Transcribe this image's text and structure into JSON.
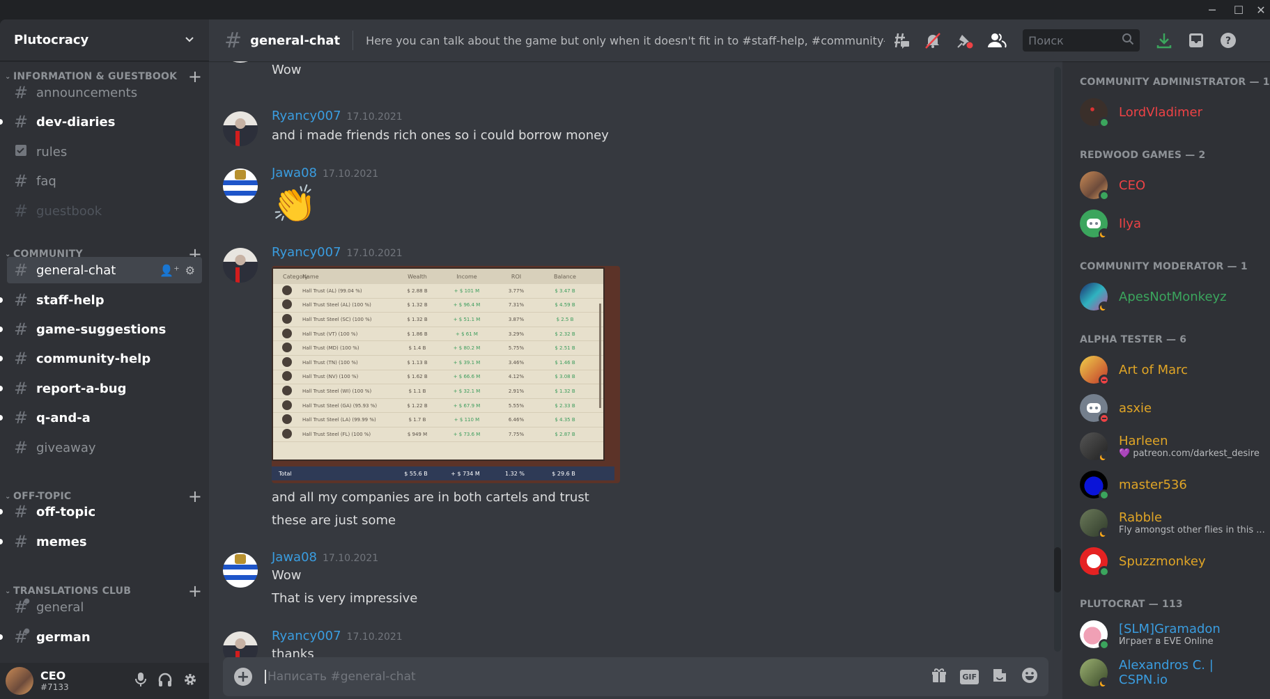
{
  "window": {
    "minimize_icon": "minimize-icon",
    "maximize_icon": "maximize-icon",
    "close_icon": "close-icon",
    "minimize": "─",
    "maximize": "☐",
    "close": "✕"
  },
  "server": {
    "name": "Plutocracy",
    "dropdown_icon": "⌄"
  },
  "sidebar": {
    "categories": [
      {
        "label": "INFORMATION & GUESTBOOK",
        "channels": [
          {
            "name": "announcements",
            "state": "read",
            "icon": "#"
          },
          {
            "name": "dev-diaries",
            "state": "unread",
            "icon": "#"
          },
          {
            "name": "rules",
            "state": "read",
            "icon": "☑"
          },
          {
            "name": "faq",
            "state": "read",
            "icon": "#"
          },
          {
            "name": "guestbook",
            "state": "muted",
            "icon": "#"
          }
        ]
      },
      {
        "label": "COMMUNITY",
        "channels": [
          {
            "name": "general-chat",
            "state": "active",
            "icon": "#"
          },
          {
            "name": "staff-help",
            "state": "unread",
            "icon": "#"
          },
          {
            "name": "game-suggestions",
            "state": "unread",
            "icon": "#"
          },
          {
            "name": "community-help",
            "state": "unread",
            "icon": "#"
          },
          {
            "name": "report-a-bug",
            "state": "unread",
            "icon": "#"
          },
          {
            "name": "q-and-a",
            "state": "unread",
            "icon": "#"
          },
          {
            "name": "giveaway",
            "state": "read",
            "icon": "#"
          }
        ]
      },
      {
        "label": "OFF-TOPIC",
        "channels": [
          {
            "name": "off-topic",
            "state": "unread",
            "icon": "#"
          },
          {
            "name": "memes",
            "state": "unread",
            "icon": "#"
          }
        ]
      },
      {
        "label": "TRANSLATIONS CLUB",
        "channels": [
          {
            "name": "general",
            "state": "read",
            "icon": "#🔒"
          },
          {
            "name": "german",
            "state": "unread",
            "icon": "#🔒"
          }
        ]
      }
    ]
  },
  "user_panel": {
    "name": "CEO",
    "tag": "#7133"
  },
  "header": {
    "channel": "general-chat",
    "topic": "Here you can talk about the game but only when it doesn't fit in to #staff-help, #community-help or ...",
    "search_placeholder": "Поиск"
  },
  "messages": [
    {
      "author": "",
      "time": "",
      "lines": [
        "Wow"
      ],
      "partial": true
    },
    {
      "author": "Ryancy007",
      "time": "17.10.2021",
      "lines": [
        "and i made friends rich ones so i could borrow money"
      ]
    },
    {
      "author": "Jawa08",
      "time": "17.10.2021",
      "emoji": "👏"
    },
    {
      "author": "Ryancy007",
      "time": "17.10.2021",
      "lines": [
        "and all my companies are in both cartels and trust",
        "these are just some"
      ],
      "attachment": {
        "columns": [
          "Category",
          "Name",
          "Wealth",
          "Income",
          "ROI",
          "Balance"
        ],
        "rows": [
          [
            "",
            "Hall Trust (AL) (99.04 %)",
            "$ 2.88 B",
            "+ $ 101 M",
            "3.77%",
            "$ 3.47 B"
          ],
          [
            "",
            "Hall Trust Steel (AL) (100 %)",
            "$ 1.32 B",
            "+ $ 96.4 M",
            "7.31%",
            "$ 4.59 B"
          ],
          [
            "",
            "Hall Trust Steel (SC) (100 %)",
            "$ 1.32 B",
            "+ $ 51.1 M",
            "3.87%",
            "$ 2.5 B"
          ],
          [
            "",
            "Hall Trust (VT) (100 %)",
            "$ 1.86 B",
            "+ $ 61 M",
            "3.29%",
            "$ 2.32 B"
          ],
          [
            "",
            "Hall Trust (MD) (100 %)",
            "$ 1.4 B",
            "+ $ 80.2 M",
            "5.75%",
            "$ 2.51 B"
          ],
          [
            "",
            "Hall Trust (TN) (100 %)",
            "$ 1.13 B",
            "+ $ 39.1 M",
            "3.46%",
            "$ 1.46 B"
          ],
          [
            "",
            "Hall Trust (NV) (100 %)",
            "$ 1.62 B",
            "+ $ 66.6 M",
            "4.12%",
            "$ 3.08 B"
          ],
          [
            "",
            "Hall Trust Steel (WI) (100 %)",
            "$ 1.1 B",
            "+ $ 32.1 M",
            "2.91%",
            "$ 1.32 B"
          ],
          [
            "",
            "Hall Trust Steel (GA) (95.93 %)",
            "$ 1.22 B",
            "+ $ 67.9 M",
            "5.55%",
            "$ 2.33 B"
          ],
          [
            "",
            "Hall Trust Steel (LA) (99.99 %)",
            "$ 1.7 B",
            "+ $ 110 M",
            "6.46%",
            "$ 4.35 B"
          ],
          [
            "",
            "Hall Trust Steel (FL) (100 %)",
            "$ 949 M",
            "+ $ 73.6 M",
            "7.75%",
            "$ 2.87 B"
          ]
        ],
        "total": {
          "label": "Total",
          "wealth": "$ 55.6 B",
          "income": "+ $ 734 M",
          "roi": "1.32 %",
          "balance": "$ 29.6 B"
        }
      }
    },
    {
      "author": "Jawa08",
      "time": "17.10.2021",
      "lines": [
        "Wow",
        "That is very impressive"
      ]
    },
    {
      "author": "Ryancy007",
      "time": "17.10.2021",
      "lines": [
        "thanks"
      ]
    }
  ],
  "composer": {
    "placeholder": "Написать #general-chat",
    "gif_label": "GIF"
  },
  "members": {
    "groups": [
      {
        "role": "COMMUNITY ADMINISTRATOR — 1",
        "members": [
          {
            "name": "LordVladimer",
            "color": "#ed4245",
            "status": "online",
            "sub": ""
          }
        ]
      },
      {
        "role": "REDWOOD GAMES — 2",
        "members": [
          {
            "name": "CEO",
            "color": "#ed4245",
            "status": "online",
            "sub": ""
          },
          {
            "name": "Ilya",
            "color": "#ed4245",
            "status": "idle",
            "sub": ""
          }
        ]
      },
      {
        "role": "COMMUNITY MODERATOR — 1",
        "members": [
          {
            "name": "ApesNotMonkeyz",
            "color": "#3ba55d",
            "status": "idle",
            "sub": ""
          }
        ]
      },
      {
        "role": "ALPHA TESTER — 6",
        "members": [
          {
            "name": "Art of Marc",
            "color": "#e0a526",
            "status": "dnd",
            "sub": ""
          },
          {
            "name": "asxie",
            "color": "#e0a526",
            "status": "dnd",
            "sub": ""
          },
          {
            "name": "Harleen",
            "color": "#e0a526",
            "status": "idle",
            "sub": "💜 patreon.com/darkest_desire"
          },
          {
            "name": "master536",
            "color": "#e0a526",
            "status": "online",
            "sub": ""
          },
          {
            "name": "Rabble",
            "color": "#e0a526",
            "status": "idle",
            "sub": "Fly amongst other flies in this ..."
          },
          {
            "name": "Spuzzmonkey",
            "color": "#e0a526",
            "status": "online",
            "sub": ""
          }
        ]
      },
      {
        "role": "PLUTOCRAT — 113",
        "members": [
          {
            "name": "[SLM]Gramadon",
            "color": "#3a9de0",
            "status": "online",
            "sub": "Играет в EVE Online"
          },
          {
            "name": "Alexandros C. | CSPN.io",
            "color": "#3a9de0",
            "status": "idle",
            "sub": ""
          }
        ]
      }
    ]
  },
  "colors": {
    "accent_link": "#3a9de0",
    "online": "#3ba55d",
    "idle": "#faa81a",
    "dnd": "#ed4245",
    "download": "#3ba55d"
  }
}
